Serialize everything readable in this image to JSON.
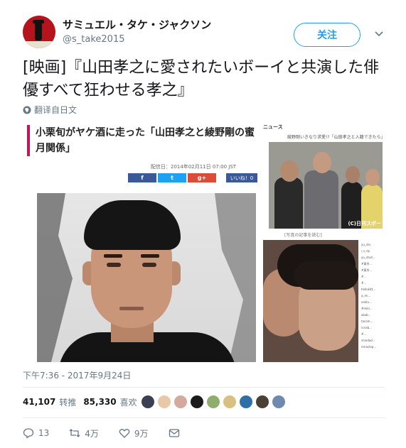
{
  "user": {
    "display_name": "サミュエル・タケ・ジャクソン",
    "handle": "@s_take2015",
    "follow_label": "关注",
    "avatar_color": "#b5141c"
  },
  "tweet": {
    "text": "[映画]『山田孝之に愛されたいボーイと共演した俳優すべて狂わせる孝之』",
    "translate_label": "翻译自日文",
    "timestamp": "下午7:36 - 2017年9月24日"
  },
  "media": {
    "article_title": "小栗旬がヤケ酒に走った「山田孝之と綾野剛の蜜月関係」",
    "article_date": "配信日：2014年02月11日 07:00 JST",
    "share_fb": "f",
    "share_tw": "t",
    "share_gp": "g+",
    "like_label": "いいね！0",
    "side_label": "ニュース",
    "side_headline": "綾野剛いきなり求愛!?「山田孝之と入籍できたら」",
    "photo_credit": "(C)日刊スポー",
    "photo_caption": "[写真の記事を読む]",
    "insta_lines": [
      "yu_stu",
      "いいね",
      "yu_stud...",
      "#東京...",
      "#東京...",
      "#...",
      "#...",
      "hellokitt...",
      "a_mi...",
      "onkla...",
      "#miki...",
      "akub...",
      "tacom...",
      "rcnab...",
      "#...",
      "shindad...",
      "miraclep..."
    ]
  },
  "stats": {
    "retweets_count": "41,107",
    "retweets_label": "转推",
    "likes_count": "85,330",
    "likes_label": "喜欢",
    "liker_colors": [
      "#3a3f52",
      "#e9c8a8",
      "#d4a9a0",
      "#1a1a1a",
      "#8fae6e",
      "#d8c080",
      "#2f6fa8",
      "#4a4036",
      "#6e8ab0"
    ]
  },
  "actions": {
    "reply_count": "13",
    "retweet_count": "4万",
    "like_count": "9万",
    "reply_icon": "reply-icon",
    "retweet_icon": "retweet-icon",
    "like_icon": "heart-icon",
    "dm_icon": "envelope-icon"
  }
}
